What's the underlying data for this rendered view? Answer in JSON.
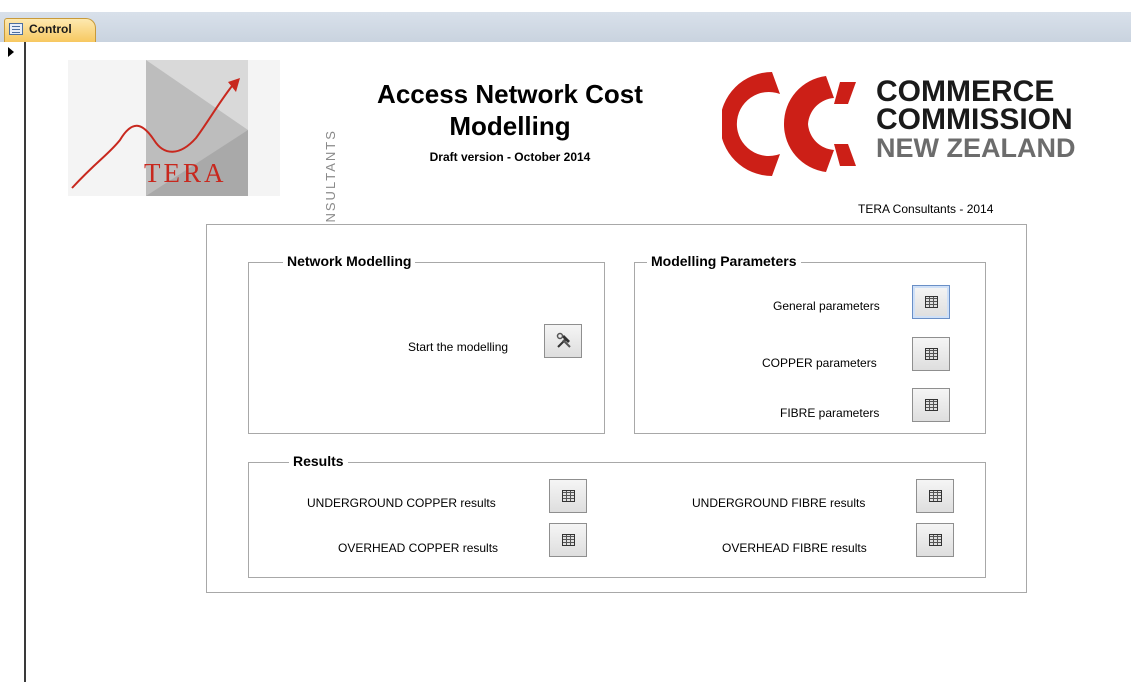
{
  "tab": {
    "label": "Control",
    "icon": "form-icon"
  },
  "header": {
    "title": "Access Network Cost Modelling",
    "subtitle": "Draft version - October 2014",
    "credit": "TERA Consultants - 2014"
  },
  "logos": {
    "tera": {
      "text": "TERA",
      "vertical": "CONSULTANTS",
      "color": "#c8281e"
    },
    "commerce": {
      "line1": "COMMERCE",
      "line2": "COMMISSION",
      "line3": "NEW ZEALAND",
      "color": "#cc1f17"
    }
  },
  "network": {
    "group_title": "Network Modelling",
    "start_label": "Start the modelling",
    "start_icon": "hammer-wrench-icon"
  },
  "parameters": {
    "group_title": "Modelling Parameters",
    "items": [
      {
        "label": "General parameters",
        "icon": "datasheet-icon"
      },
      {
        "label": "COPPER parameters",
        "icon": "datasheet-icon"
      },
      {
        "label": "FIBRE parameters",
        "icon": "datasheet-icon"
      }
    ]
  },
  "results": {
    "group_title": "Results",
    "items": [
      {
        "label": "UNDERGROUND COPPER results",
        "icon": "datasheet-icon"
      },
      {
        "label": "OVERHEAD COPPER results",
        "icon": "datasheet-icon"
      },
      {
        "label": "UNDERGROUND FIBRE results",
        "icon": "datasheet-icon"
      },
      {
        "label": "OVERHEAD FIBRE results",
        "icon": "datasheet-icon"
      }
    ]
  }
}
